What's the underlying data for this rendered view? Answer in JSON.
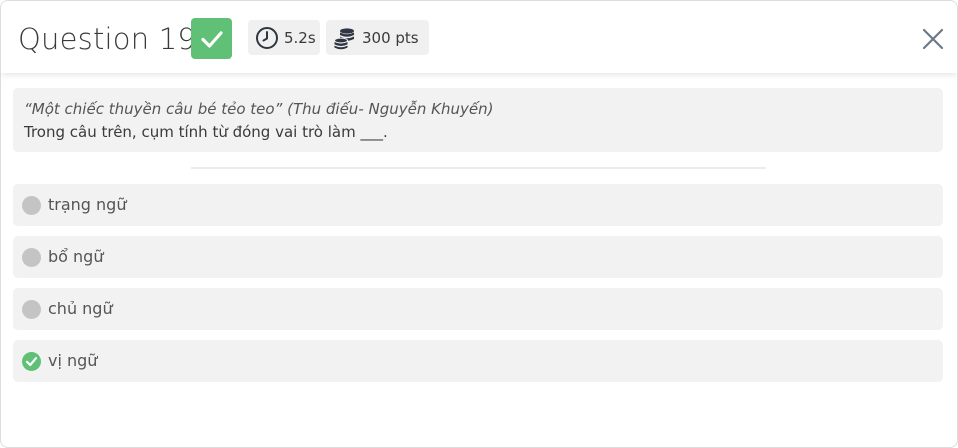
{
  "header": {
    "title": "Question 19",
    "status_icon": "check-icon",
    "time": "5.2s",
    "time_icon": "clock-icon",
    "points": "300 pts",
    "points_icon": "coins-icon",
    "close_icon": "close-icon"
  },
  "question": {
    "quote": "“Một chiếc thuyền câu bé tẻo teo” (Thu điếu- Nguyễn Khuyến)",
    "prompt": "Trong câu trên, cụm tính từ đóng vai trò làm ___."
  },
  "options": [
    {
      "label": "trạng ngữ",
      "state": "unselected"
    },
    {
      "label": "bổ ngữ",
      "state": "unselected"
    },
    {
      "label": "chủ ngữ",
      "state": "unselected"
    },
    {
      "label": "vị ngữ",
      "state": "correct"
    }
  ],
  "colors": {
    "correct_green": "#5fc076",
    "option_bg": "#f2f2f2",
    "radio_gray": "#c4c4c4",
    "text_dark": "#3a3a3a"
  }
}
